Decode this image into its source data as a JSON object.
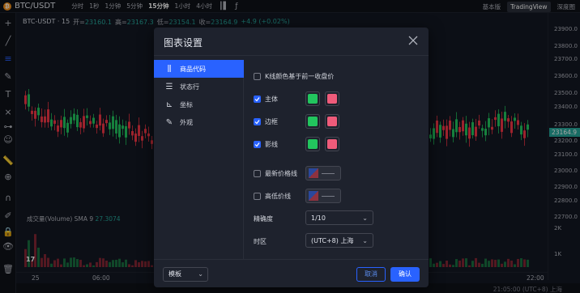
{
  "header": {
    "symbol": "BTC/USDT",
    "intervals": [
      "分时",
      "1秒",
      "1分钟",
      "5分钟",
      "15分钟",
      "1小时",
      "4小时"
    ],
    "active_interval": "15分钟",
    "views": [
      "基本版",
      "TradingView",
      "深度图"
    ],
    "active_view": "TradingView"
  },
  "legend": {
    "pair": "BTC-USDT · 15",
    "open_label": "开=",
    "open": "23160.1",
    "high_label": "高=",
    "high": "23167.3",
    "low_label": "低=",
    "low": "23154.1",
    "close_label": "收=",
    "close": "23164.9",
    "change": "+4.9 (+0.02%)"
  },
  "volume_legend": {
    "label": "成交量(Volume) SMA 9",
    "value": "27.3074"
  },
  "price_axis": [
    "23900.0",
    "23800.0",
    "23700.0",
    "23600.0",
    "23500.0",
    "23400.0",
    "23300.0",
    "23200.0",
    "23100.0",
    "23000.0",
    "22900.0",
    "22800.0",
    "22700.0",
    "2K",
    "1K"
  ],
  "current_price": "23164.9",
  "time_axis": [
    "25",
    "06:00",
    "22:00"
  ],
  "status_time": "21:05:00 (UTC+8) 上海",
  "colors": {
    "up": "#26a69a",
    "up_bright": "#22c55e",
    "down": "#f23645",
    "down_pink": "#ef5b7a",
    "accent": "#2962ff"
  },
  "dialog": {
    "title": "图表设置",
    "nav": [
      {
        "label": "商品代码",
        "icon": "candles-icon",
        "active": true
      },
      {
        "label": "状态行",
        "icon": "status-line-icon",
        "active": false
      },
      {
        "label": "坐标",
        "icon": "axes-icon",
        "active": false
      },
      {
        "label": "外观",
        "icon": "brush-icon",
        "active": false
      }
    ],
    "color_on_prev_close": {
      "label": "K线颜色基于前一收盘价",
      "checked": false
    },
    "body": {
      "label": "主体",
      "checked": true
    },
    "borders": {
      "label": "边框",
      "checked": true
    },
    "wick": {
      "label": "影线",
      "checked": true
    },
    "last_price_line": {
      "label": "最新价格线",
      "checked": false
    },
    "high_low_line": {
      "label": "高低价线",
      "checked": false
    },
    "precision": {
      "label": "精确度",
      "value": "1/10"
    },
    "timezone": {
      "label": "时区",
      "value": "(UTC+8) 上海"
    },
    "template_button": "模板",
    "cancel_button": "取消",
    "ok_button": "确认"
  }
}
